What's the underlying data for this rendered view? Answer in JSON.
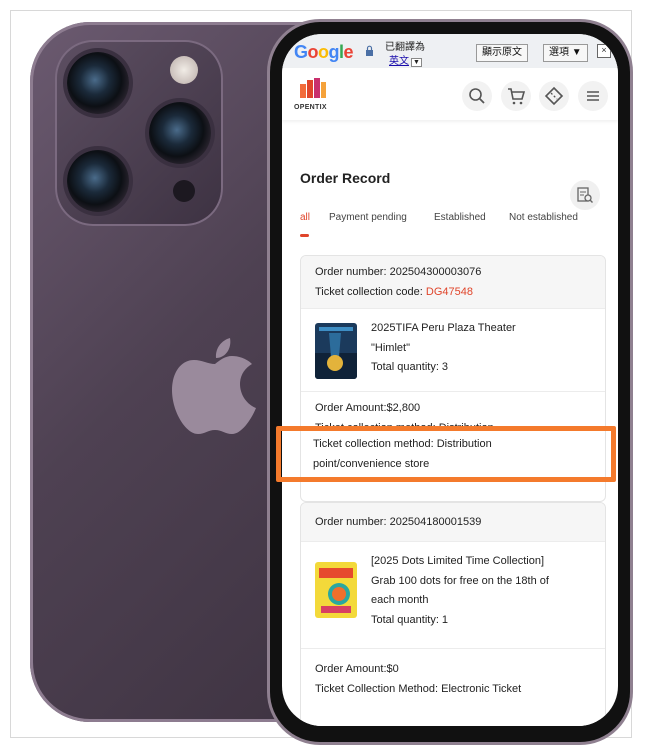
{
  "translate_bar": {
    "translated_label": "已翻譯為",
    "language": "英文",
    "show_original": "顯示原文",
    "options": "選項 ▼",
    "close": "×"
  },
  "app": {
    "logo_text": "OPENTIX",
    "accent": "#e0452b"
  },
  "page": {
    "title": "Order Record",
    "tabs": [
      "all",
      "Payment pending",
      "Established",
      "Not established"
    ],
    "active_tab": "all"
  },
  "orders": [
    {
      "order_number": "Order number: 202504300003076",
      "collection_code_label": "Ticket collection code: ",
      "collection_code": "DG47548",
      "product_lines": [
        "2025TIFA Peru Plaza Theater",
        "\"Himlet\""
      ],
      "quantity": "Total quantity: 3",
      "amount": "Order Amount:$2,800",
      "method_line1": "Ticket collection method: Distribution",
      "method_line2": "point/convenience store"
    },
    {
      "order_number": "Order number: 202504180001539",
      "product_lines": [
        "[2025 Dots Limited Time Collection]",
        "Grab 100 dots for free on the 18th of",
        "each month"
      ],
      "quantity": "Total quantity: 1",
      "amount": "Order Amount:$0",
      "method": "Ticket Collection Method: Electronic Ticket"
    }
  ]
}
